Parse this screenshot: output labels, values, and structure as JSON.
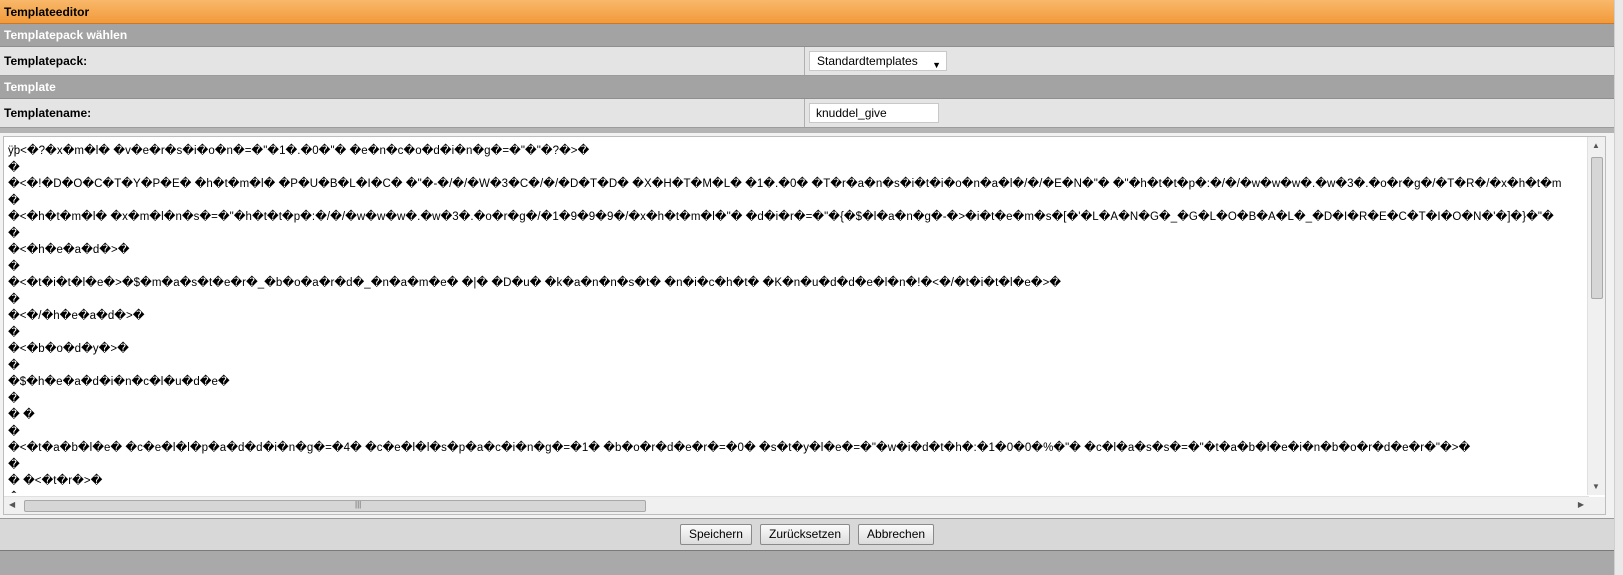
{
  "window": {
    "title": "Templateeditor"
  },
  "section_pack": {
    "header": "Templatepack wählen",
    "label": "Templatepack:",
    "selected": "Standardtemplates"
  },
  "section_template": {
    "header": "Template",
    "label": "Templatename:",
    "value": "knuddel_give"
  },
  "editor": {
    "lines": [
      "ÿþ<�?�x�m�l� �v�e�r�s�i�o�n�=�\"�1�.�0�\"� �e�n�c�o�d�i�n�g�=�\"�\"�?�>�",
      "�",
      "�<�!�D�O�C�T�Y�P�E� �h�t�m�l� �P�U�B�L�I�C� �\"�-�/�/�W�3�C�/�/�D�T�D� �X�H�T�M�L� �1�.�0� �T�r�a�n�s�i�t�i�o�n�a�l�/�/�E�N�\"� �\"�h�t�t�p�:�/�/�w�w�w�.�w�3�.�o�r�g�/�T�R�/�x�h�t�m",
      "�",
      "�<�h�t�m�l� �x�m�l�n�s�=�\"�h�t�t�p�:�/�/�w�w�w�.�w�3�.�o�r�g�/�1�9�9�9�/�x�h�t�m�l�\"� �d�i�r�=�\"�{�$�l�a�n�g�-�>�i�t�e�m�s�[�'�L�A�N�G�_�G�L�O�B�A�L�_�D�I�R�E�C�T�I�O�N�'�]�}�\"�",
      "�",
      "�<�h�e�a�d�>�",
      "�",
      "�<�t�i�t�l�e�>�$�m�a�s�t�e�r�_�b�o�a�r�d�_�n�a�m�e� �|� �D�u� �k�a�n�n�s�t� �n�i�c�h�t� �K�n�u�d�d�e�l�n�!�<�/�t�i�t�l�e�>�",
      "�",
      "�<�/�h�e�a�d�>�",
      "�",
      "�<�b�o�d�y�>�",
      "�",
      "�$�h�e�a�d�i�n�c�l�u�d�e�",
      "�",
      "� �",
      "�",
      "�<�t�a�b�l�e� �c�e�l�l�p�a�d�d�i�n�g�=�4� �c�e�l�l�s�p�a�c�i�n�g�=�1� �b�o�r�d�e�r�=�0� �s�t�y�l�e�=�\"�w�i�d�t�h�:�1�0�0�%�\"� �c�l�a�s�s�=�\"�t�a�b�l�e�i�n�b�o�r�d�e�r�\"�>�",
      "�",
      "� �<�t�r�>�",
      "�"
    ]
  },
  "buttons": {
    "save": "Speichern",
    "reset": "Zurücksetzen",
    "cancel": "Abbrechen"
  }
}
